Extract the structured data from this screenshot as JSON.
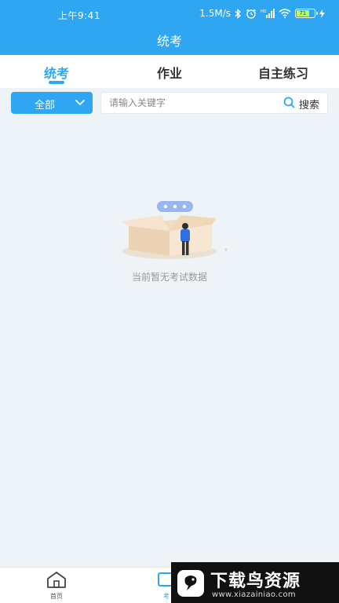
{
  "status_bar": {
    "time": "上午9:41",
    "net_speed": "1.5M/s",
    "battery_level": "71"
  },
  "header": {
    "title": "统考"
  },
  "tabs": [
    {
      "label": "统考",
      "active": true
    },
    {
      "label": "作业",
      "active": false
    },
    {
      "label": "自主练习",
      "active": false
    }
  ],
  "filter": {
    "selected": "全部"
  },
  "search": {
    "placeholder": "请输入关键字",
    "button_label": "搜索"
  },
  "empty_state": {
    "message": "当前暂无考试数据"
  },
  "bottom_nav": [
    {
      "label": "首页",
      "icon": "home-icon",
      "active": false
    },
    {
      "label": "考",
      "icon": "exam-icon",
      "active": true
    }
  ],
  "watermark": {
    "text": "下载鸟资源",
    "url": "www.xiazainiao.com"
  },
  "colors": {
    "accent": "#2fa6f2",
    "background": "#eef3f7"
  }
}
